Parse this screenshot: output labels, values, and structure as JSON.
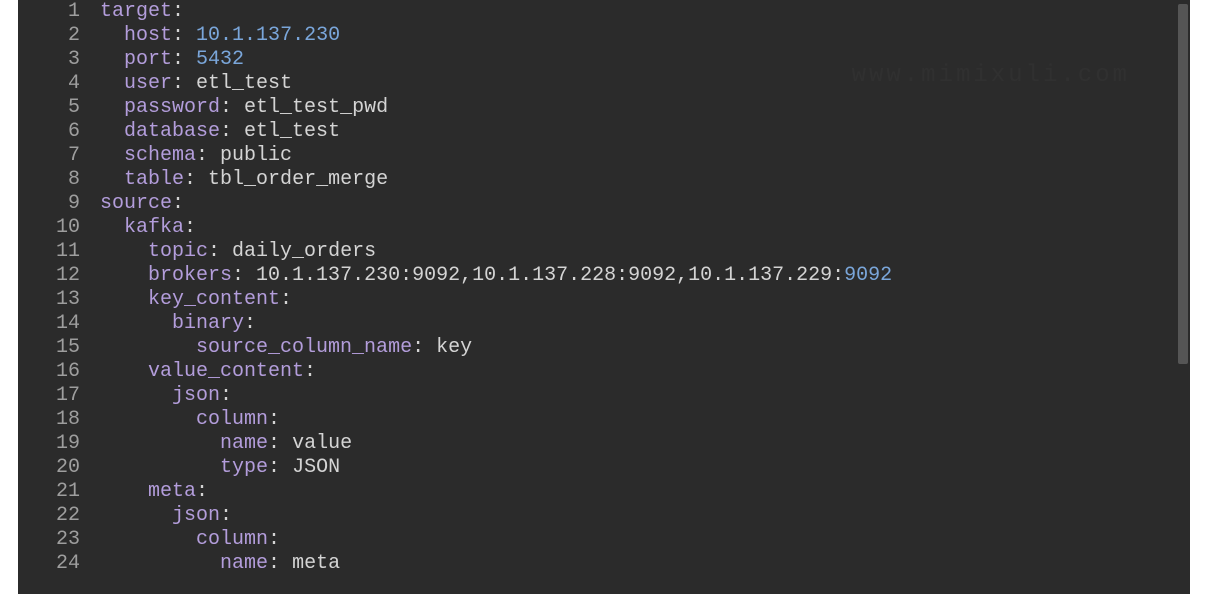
{
  "watermark": "www.mimixuli.com",
  "lines": [
    {
      "n": 1,
      "indent": 0,
      "key": "target",
      "val": ""
    },
    {
      "n": 2,
      "indent": 1,
      "key": "host",
      "val": " 10.1.137.230",
      "cls": "num"
    },
    {
      "n": 3,
      "indent": 1,
      "key": "port",
      "val": " 5432",
      "cls": "num"
    },
    {
      "n": 4,
      "indent": 1,
      "key": "user",
      "val": " etl_test"
    },
    {
      "n": 5,
      "indent": 1,
      "key": "password",
      "val": " etl_test_pwd"
    },
    {
      "n": 6,
      "indent": 1,
      "key": "database",
      "val": " etl_test"
    },
    {
      "n": 7,
      "indent": 1,
      "key": "schema",
      "val": " public"
    },
    {
      "n": 8,
      "indent": 1,
      "key": "table",
      "val": " tbl_order_merge"
    },
    {
      "n": 9,
      "indent": 0,
      "key": "source",
      "val": ""
    },
    {
      "n": 10,
      "indent": 1,
      "key": "kafka",
      "val": ""
    },
    {
      "n": 11,
      "indent": 2,
      "key": "topic",
      "val": " daily_orders"
    },
    {
      "n": 12,
      "indent": 2,
      "key": "brokers",
      "val": " 10.1.137.230:9092,10.1.137.228:9092,10.1.137.229:",
      "tail": "9092",
      "tailcls": "num"
    },
    {
      "n": 13,
      "indent": 2,
      "key": "key_content",
      "val": ""
    },
    {
      "n": 14,
      "indent": 3,
      "key": "binary",
      "val": ""
    },
    {
      "n": 15,
      "indent": 4,
      "key": "source_column_name",
      "val": " key"
    },
    {
      "n": 16,
      "indent": 2,
      "key": "value_content",
      "val": ""
    },
    {
      "n": 17,
      "indent": 3,
      "key": "json",
      "val": ""
    },
    {
      "n": 18,
      "indent": 4,
      "key": "column",
      "val": ""
    },
    {
      "n": 19,
      "indent": 5,
      "key": "name",
      "val": " value"
    },
    {
      "n": 20,
      "indent": 5,
      "key": "type",
      "val": " JSON"
    },
    {
      "n": 21,
      "indent": 2,
      "key": "meta",
      "val": ""
    },
    {
      "n": 22,
      "indent": 3,
      "key": "json",
      "val": ""
    },
    {
      "n": 23,
      "indent": 4,
      "key": "column",
      "val": ""
    },
    {
      "n": 24,
      "indent": 5,
      "key": "name",
      "val": " meta"
    }
  ]
}
